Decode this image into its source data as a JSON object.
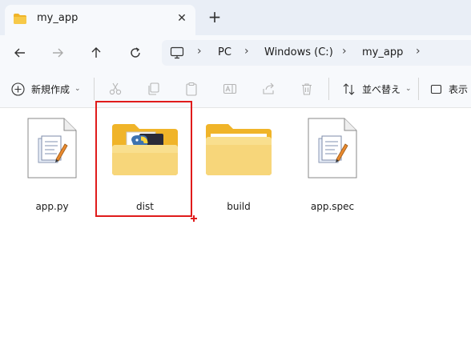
{
  "tab": {
    "title": "my_app",
    "close_glyph": "✕",
    "new_tab_glyph": "+"
  },
  "nav": {
    "back_icon": "arrow-left-icon",
    "forward_icon": "arrow-right-icon",
    "up_icon": "arrow-up-icon",
    "refresh_icon": "refresh-icon",
    "breadcrumbs": [
      "PC",
      "Windows (C:)",
      "my_app"
    ],
    "separator": "›"
  },
  "toolbar": {
    "new_label": "新規作成",
    "sort_label": "並べ替え",
    "view_label": "表示",
    "chevron": "⌄"
  },
  "files": [
    {
      "name": "app.py",
      "type": "file",
      "icon": "python-file-icon"
    },
    {
      "name": "dist",
      "type": "folder",
      "icon": "folder-with-content-icon"
    },
    {
      "name": "build",
      "type": "folder",
      "icon": "folder-icon"
    },
    {
      "name": "app.spec",
      "type": "file",
      "icon": "spec-file-icon"
    }
  ],
  "colors": {
    "accent_red": "#e01b1b",
    "folder_yellow": "#f7c948",
    "tabstrip_bg": "#e9eef6"
  }
}
